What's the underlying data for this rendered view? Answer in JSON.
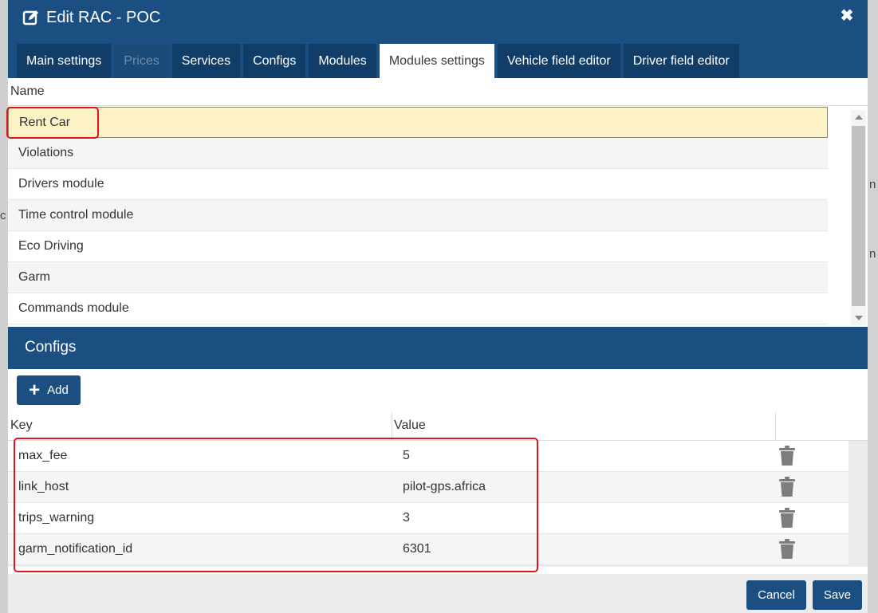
{
  "dialog": {
    "title": "Edit RAC - POC",
    "close_icon": "close-icon",
    "edit_icon": "edit-icon"
  },
  "tabs": [
    {
      "label": "Main settings",
      "state": "normal"
    },
    {
      "label": "Prices",
      "state": "disabled"
    },
    {
      "label": "Services",
      "state": "normal"
    },
    {
      "label": "Configs",
      "state": "normal"
    },
    {
      "label": "Modules",
      "state": "normal"
    },
    {
      "label": "Modules settings",
      "state": "active"
    },
    {
      "label": "Vehicle field editor",
      "state": "normal"
    },
    {
      "label": "Driver field editor",
      "state": "normal"
    }
  ],
  "modules": {
    "header": "Name",
    "items": [
      "Rent Car",
      "Violations",
      "Drivers module",
      "Time control module",
      "Eco Driving",
      "Garm",
      "Commands module"
    ],
    "selected": "Rent Car"
  },
  "configs": {
    "title": "Configs",
    "add_label": "Add",
    "columns": {
      "key": "Key",
      "value": "Value"
    },
    "rows": [
      {
        "key": "max_fee",
        "value": "5"
      },
      {
        "key": "link_host",
        "value": "pilot-gps.africa"
      },
      {
        "key": "trips_warning",
        "value": "3"
      },
      {
        "key": "garm_notification_id",
        "value": "6301"
      }
    ],
    "row_action_icon": "trash-icon"
  },
  "background": {
    "right_letters": [
      "n",
      "n"
    ],
    "left_letter": "c"
  },
  "footer": {
    "cancel_label": "Cancel",
    "save_label": "Save"
  },
  "colors": {
    "header": "#1b4f82",
    "tab": "#113e68",
    "selected_row": "#fdf2c5",
    "highlight": "#e0141e"
  }
}
